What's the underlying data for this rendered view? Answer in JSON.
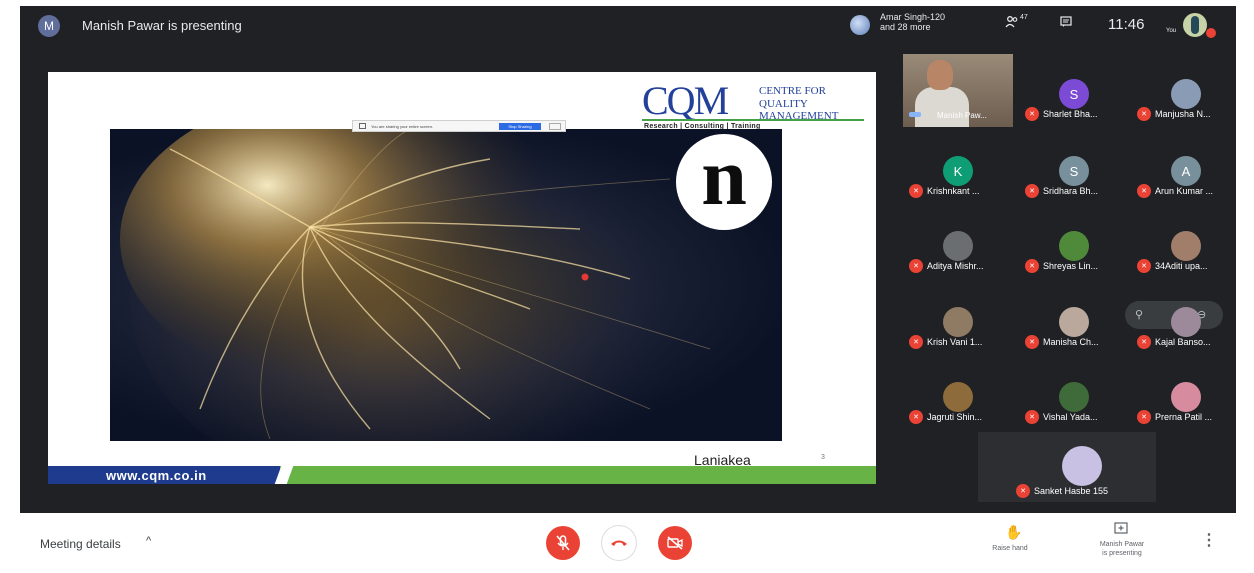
{
  "topbar": {
    "presenter_initial": "M",
    "presenter_text": "Manish Pawar is presenting",
    "join_line1": "Amar Singh-120",
    "join_line2": "and 28 more",
    "participant_count": "47",
    "clock": "11:46",
    "you_label": "You"
  },
  "slide": {
    "logo_main": "CQM",
    "logo_line1": "CENTRE FOR",
    "logo_line2": "QUALITY MANAGEMENT",
    "logo_tagline": "Research | Consulting | Training",
    "share_text": "You are sharing your entire screen.",
    "share_stop": "Stop Sharing",
    "n_logo": "n",
    "title": "Laniakea",
    "page_number": "3",
    "footer_url": "www.cqm.co.in"
  },
  "presenter_tile": {
    "name": "Manish Paw..."
  },
  "participants": [
    {
      "name": "Sharlet Bha...",
      "initial": "S",
      "color": "#7b4bd6"
    },
    {
      "name": "Manjusha N...",
      "initial": "",
      "color": "#8a9cb5"
    },
    {
      "name": "Krishnkant ...",
      "initial": "K",
      "color": "#0f9d75"
    },
    {
      "name": "Sridhara Bh...",
      "initial": "S",
      "color": "#78909c"
    },
    {
      "name": "Arun Kumar ...",
      "initial": "A",
      "color": "#78909c"
    },
    {
      "name": "Aditya Mishr...",
      "initial": "",
      "color": "#6b6e70"
    },
    {
      "name": "Shreyas Lin...",
      "initial": "",
      "color": "#4f8a3b"
    },
    {
      "name": "34Aditi upa...",
      "initial": "",
      "color": "#a07e6a"
    },
    {
      "name": "Krish Vani 1...",
      "initial": "",
      "color": "#8f7a63"
    },
    {
      "name": "Manisha Ch...",
      "initial": "",
      "color": "#b9a89b"
    },
    {
      "name": "Kajal Banso...",
      "initial": "",
      "color": "#9c8a9a"
    },
    {
      "name": "Jagruti Shin...",
      "initial": "",
      "color": "#8e6b3a"
    },
    {
      "name": "Vishal Yada...",
      "initial": "",
      "color": "#3f6b3a"
    },
    {
      "name": "Prerna Patil ...",
      "initial": "",
      "color": "#d68c9e"
    },
    {
      "name": "Sanket Hasbe 155",
      "initial": "",
      "color": "#c9c1e4"
    }
  ],
  "bottombar": {
    "meeting_details": "Meeting details",
    "raise_hand": "Raise hand",
    "presenting_line1": "Manish Pawar",
    "presenting_line2": "is presenting"
  },
  "icons": {
    "mic": "mic-off-icon",
    "hangup": "hangup-icon",
    "camera": "camera-off-icon",
    "people": "people-icon",
    "chat": "chat-icon",
    "hand": "hand-icon",
    "present": "present-icon",
    "more": "more-vert-icon"
  },
  "colors": {
    "meet_bg": "#202124",
    "red": "#ea4335",
    "cqm_blue": "#23409a",
    "cqm_green": "#67b346"
  }
}
